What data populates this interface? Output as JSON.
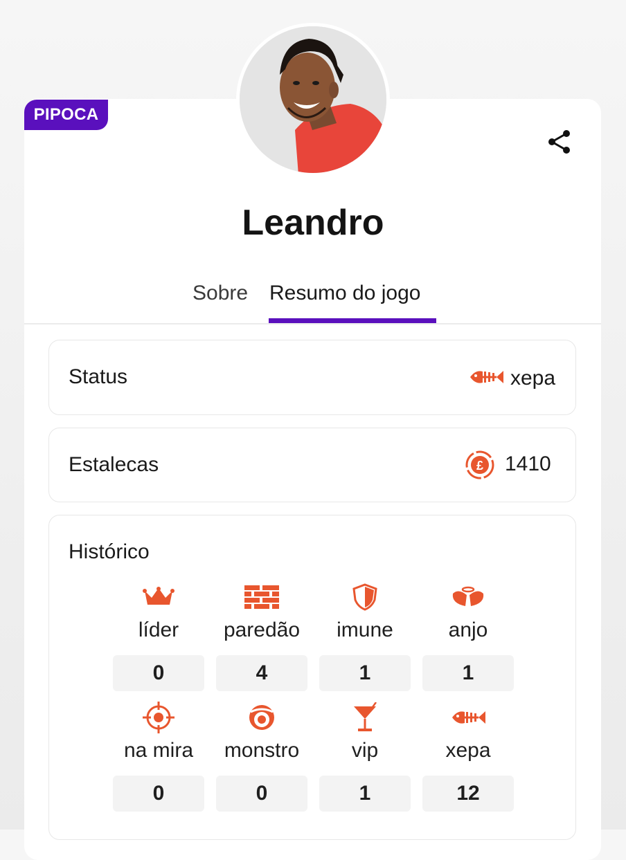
{
  "badge": "PIPOCA",
  "name": "Leandro",
  "tabs": {
    "sobre": "Sobre",
    "resumo": "Resumo do jogo"
  },
  "status": {
    "label": "Status",
    "value": "xepa",
    "icon": "fish-bone-icon"
  },
  "estalecas": {
    "label": "Estalecas",
    "value": "1410",
    "icon": "estaleca-coin-icon"
  },
  "historico": {
    "title": "Histórico",
    "items": [
      {
        "label": "líder",
        "count": "0",
        "icon": "crown-icon"
      },
      {
        "label": "paredão",
        "count": "4",
        "icon": "brick-wall-icon"
      },
      {
        "label": "imune",
        "count": "1",
        "icon": "shield-icon"
      },
      {
        "label": "anjo",
        "count": "1",
        "icon": "angel-wings-icon"
      },
      {
        "label": "na mira",
        "count": "0",
        "icon": "crosshair-icon"
      },
      {
        "label": "monstro",
        "count": "0",
        "icon": "monster-eye-icon"
      },
      {
        "label": "vip",
        "count": "1",
        "icon": "cocktail-icon"
      },
      {
        "label": "xepa",
        "count": "12",
        "icon": "fish-bone-icon"
      }
    ]
  },
  "colors": {
    "accent": "#5a10bd",
    "icon": "#e8562e"
  }
}
